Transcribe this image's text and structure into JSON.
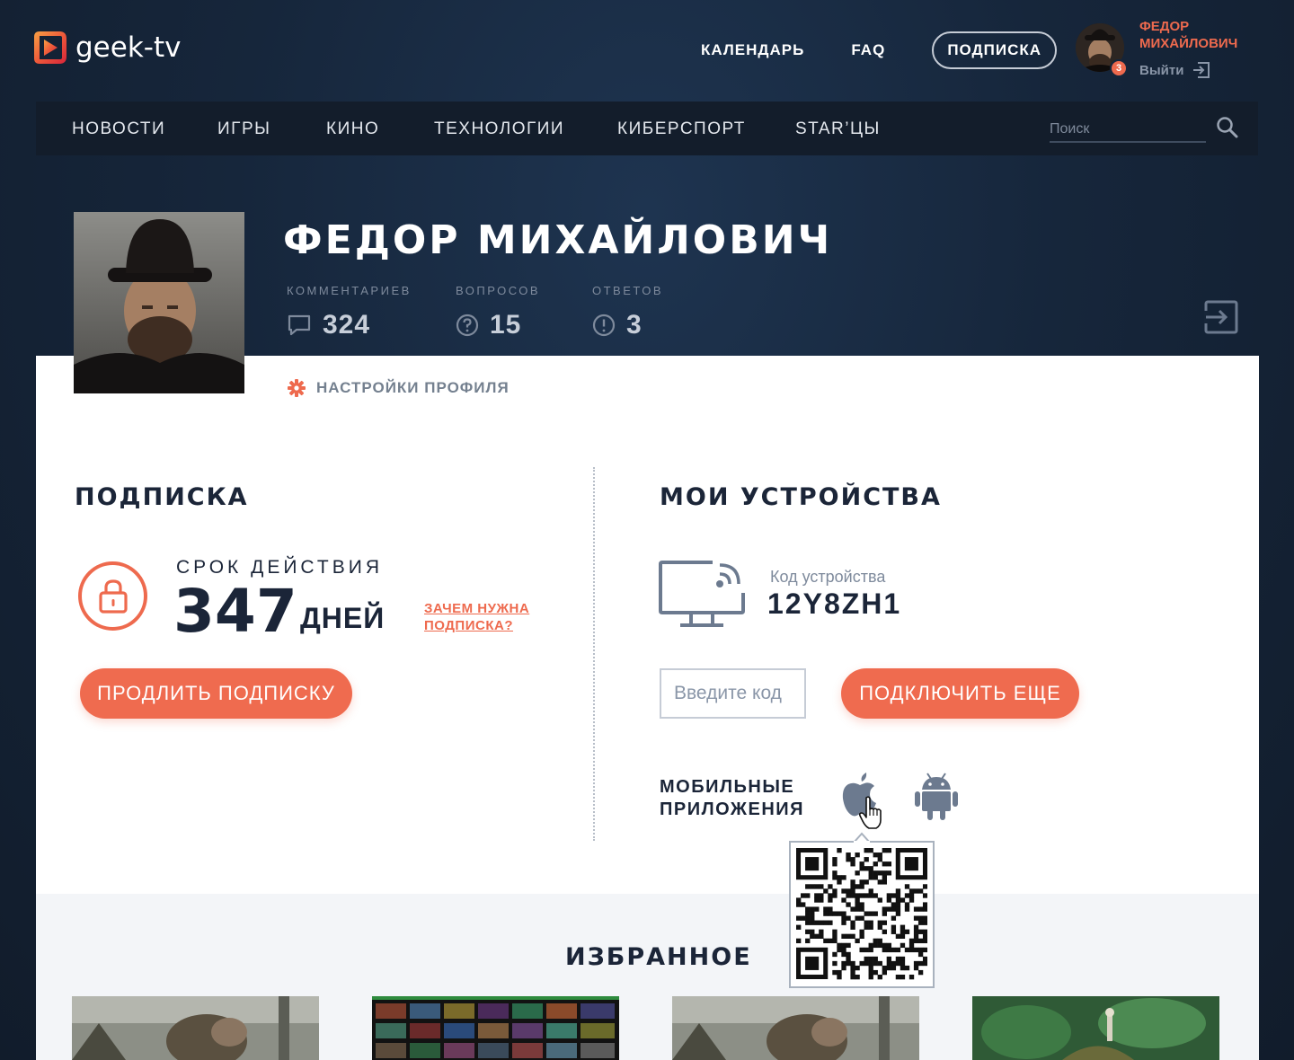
{
  "brand": {
    "name": "geek-tv",
    "accent": "#ee6a4e"
  },
  "header": {
    "links": {
      "calendar": "КАЛЕНДАРЬ",
      "faq": "FAQ",
      "subscription": "ПОДПИСКА"
    },
    "user": {
      "name": "ФЕДОР МИХАЙЛОВИЧ",
      "notifications": "3",
      "logout": "Выйти"
    }
  },
  "nav": {
    "items": [
      "НОВОСТИ",
      "ИГРЫ",
      "КИНО",
      "ТЕХНОЛОГИИ",
      "КИБЕРСПОРТ",
      "STAR’ЦЫ"
    ],
    "search_placeholder": "Поиск"
  },
  "profile": {
    "name": "ФЕДОР МИХАЙЛОВИЧ",
    "stats": [
      {
        "label": "КОММЕНТАРИЕВ",
        "value": "324",
        "icon": "comment-icon"
      },
      {
        "label": "ВОПРОСОВ",
        "value": "15",
        "icon": "question-icon"
      },
      {
        "label": "ОТВЕТОВ",
        "value": "3",
        "icon": "exclamation-icon"
      }
    ],
    "settings_label": "НАСТРОЙКИ ПРОФИЛЯ"
  },
  "subscription": {
    "title": "ПОДПИСКА",
    "term_label": "СРОК ДЕЙСТВИЯ",
    "days": "347",
    "days_unit": "ДНЕЙ",
    "why_line1": "ЗАЧЕМ НУЖНА",
    "why_line2": "ПОДПИСКА?",
    "extend_button": "ПРОДЛИТЬ ПОДПИСКУ"
  },
  "devices": {
    "title": "МОИ УСТРОЙСТВА",
    "code_label": "Код устройства",
    "code": "12Y8ZH1",
    "input_placeholder": "Введите код",
    "connect_button": "ПОДКЛЮЧИТЬ ЕЩЕ",
    "mobile_line1": "МОБИЛЬНЫЕ",
    "mobile_line2": "ПРИЛОЖЕНИЯ"
  },
  "favorites": {
    "title": "ИЗБРАННОЕ"
  }
}
